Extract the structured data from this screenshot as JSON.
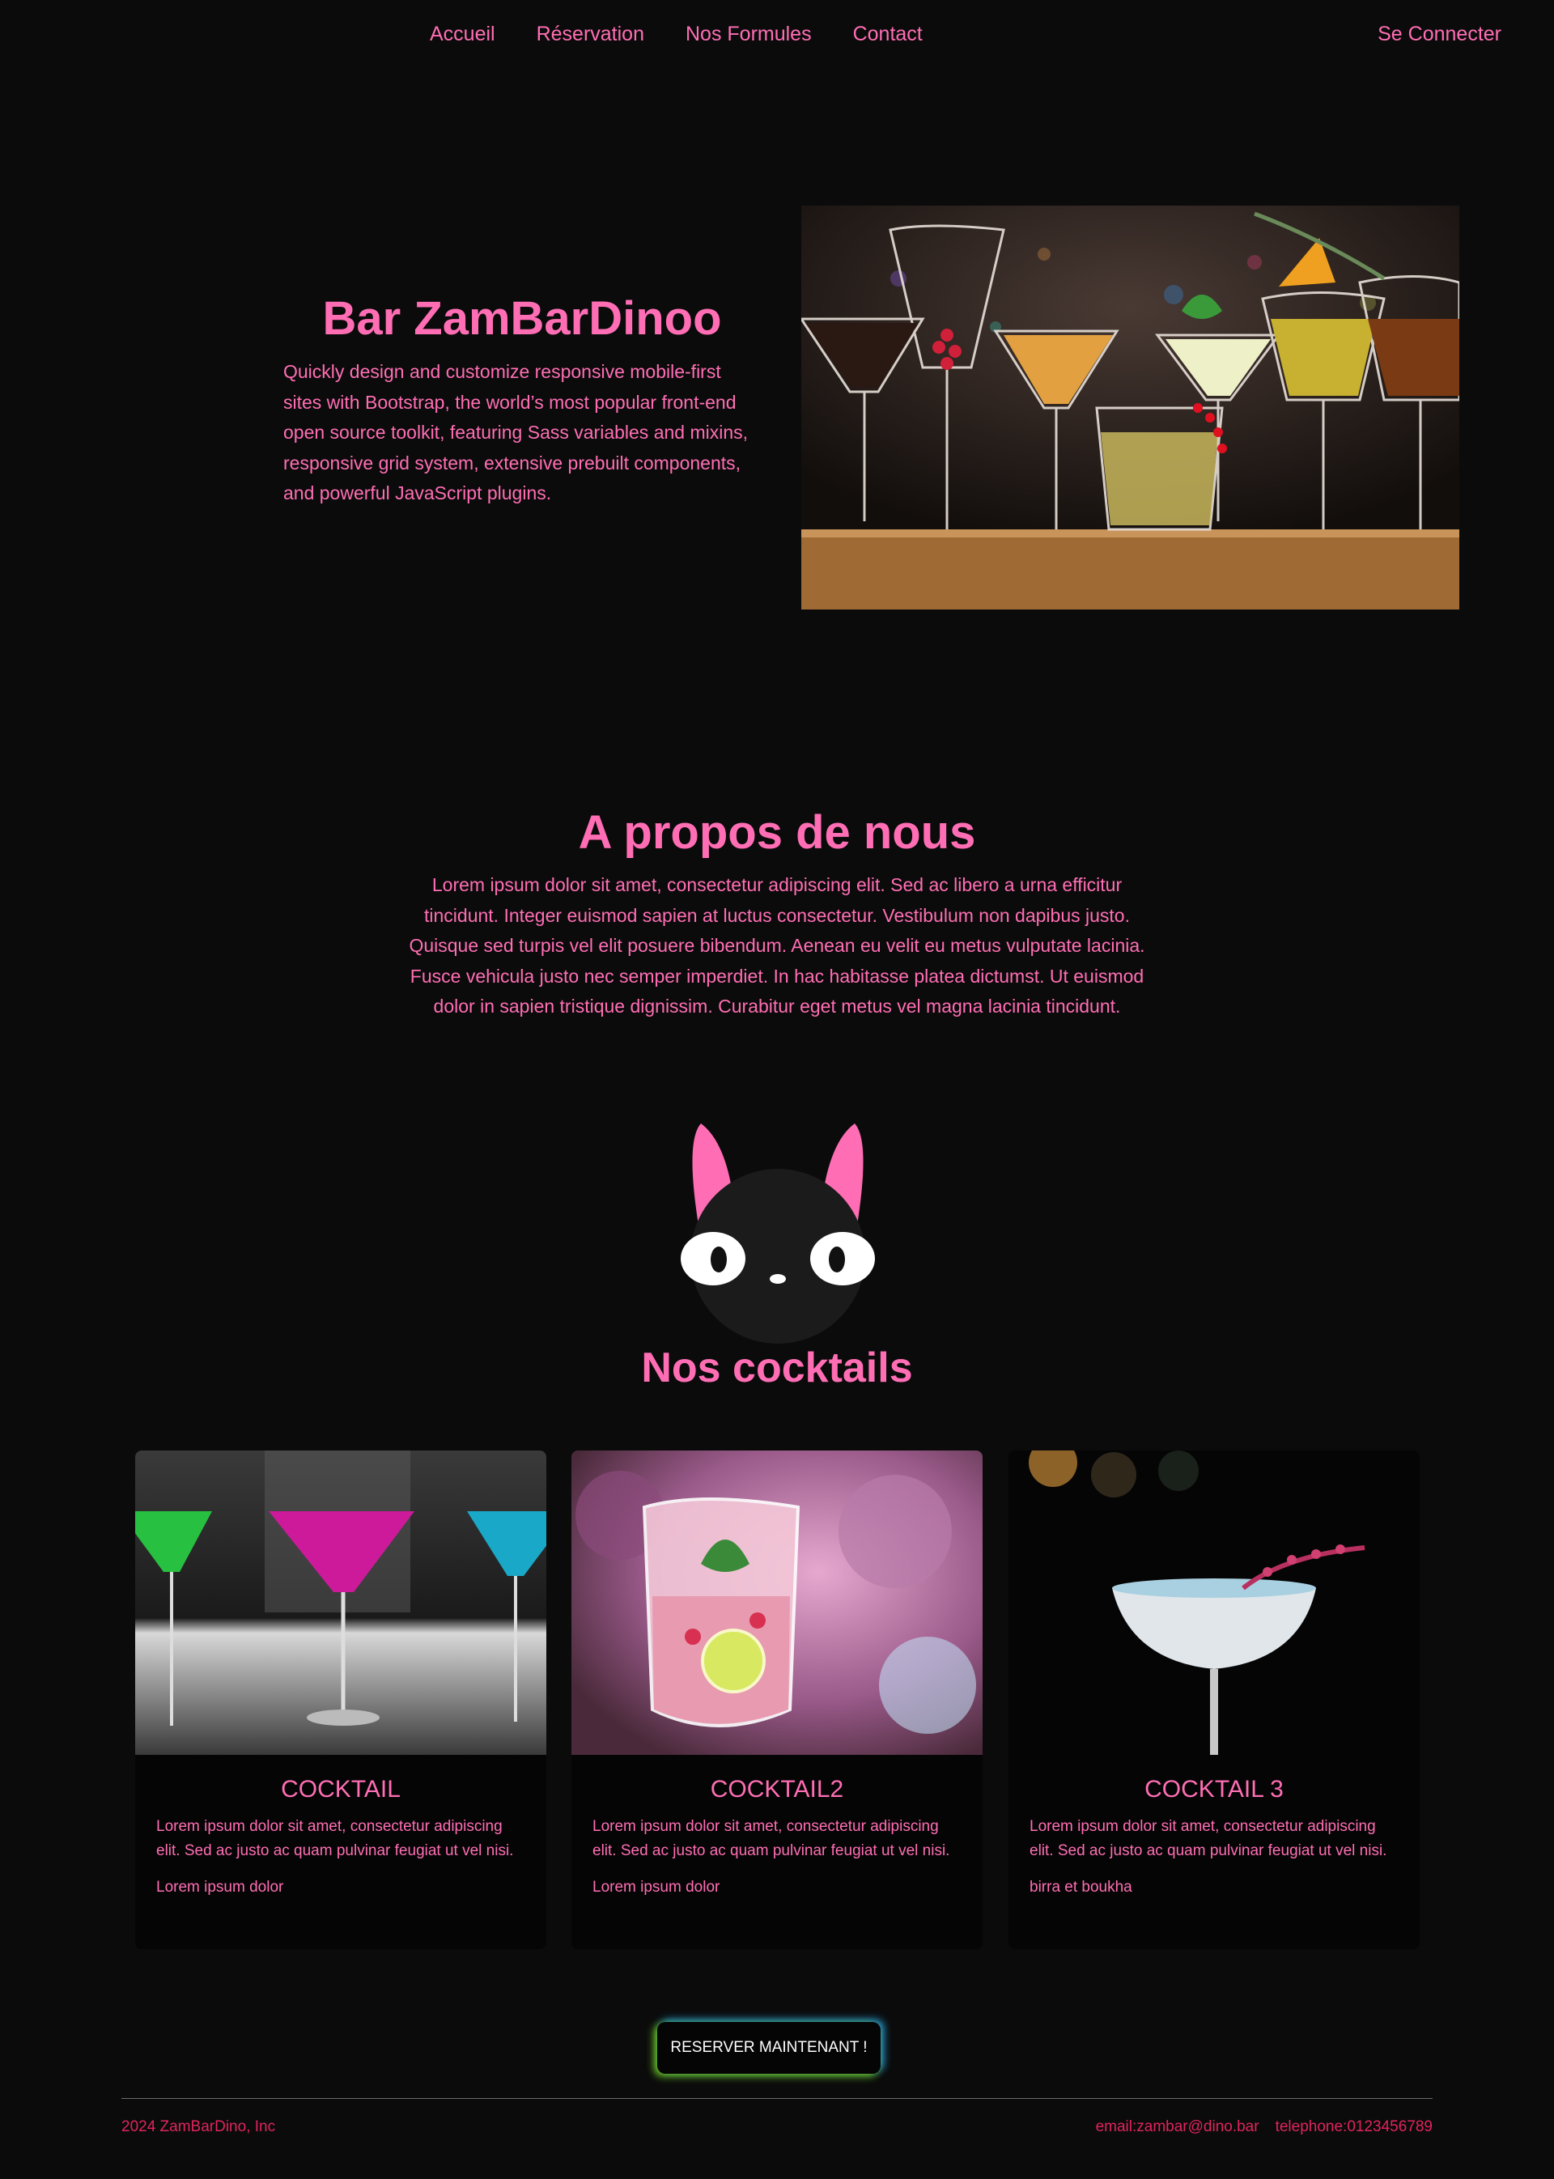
{
  "nav": {
    "links": [
      "Accueil",
      "Réservation",
      "Nos Formules",
      "Contact"
    ],
    "login": "Se Connecter"
  },
  "hero": {
    "title": "Bar ZamBarDinoo",
    "description": "Quickly design and customize responsive mobile-first sites with Bootstrap, the world’s most popular front-end open source toolkit, featuring Sass variables and mixins, responsive grid system, extensive prebuilt components, and powerful JavaScript plugins."
  },
  "about": {
    "title": "A propos de nous",
    "text": "Lorem ipsum dolor sit amet, consectetur adipiscing elit. Sed ac libero a urna efficitur tincidunt. Integer euismod sapien at luctus consectetur. Vestibulum non dapibus justo. Quisque sed turpis vel elit posuere bibendum. Aenean eu velit eu metus vulputate lacinia. Fusce vehicula justo nec semper imperdiet. In hac habitasse platea dictumst. Ut euismod dolor in sapien tristique dignissim. Curabitur eget metus vel magna lacinia tincidunt."
  },
  "cocktails": {
    "title": "Nos cocktails",
    "cards": [
      {
        "title": "COCKTAIL",
        "text": "Lorem ipsum dolor sit amet, consectetur adipiscing elit. Sed ac justo ac quam pulvinar feugiat ut vel nisi.",
        "footer": "Lorem ipsum dolor"
      },
      {
        "title": "COCKTAIL2",
        "text": "Lorem ipsum dolor sit amet, consectetur adipiscing elit. Sed ac justo ac quam pulvinar feugiat ut vel nisi.",
        "footer": "Lorem ipsum dolor"
      },
      {
        "title": "COCKTAIL 3",
        "text": "Lorem ipsum dolor sit amet, consectetur adipiscing elit. Sed ac justo ac quam pulvinar feugiat ut vel nisi.",
        "footer": "birra et boukha"
      }
    ]
  },
  "cta": {
    "label": "RESERVER MAINTENANT !"
  },
  "footer": {
    "copyright": "2024 ZamBarDino, Inc",
    "email": "email:zambar@dino.bar",
    "phone": "telephone:0123456789"
  },
  "colors": {
    "accent": "#ff6eb4",
    "background": "#0b0b0b",
    "footer_text": "#e0245e"
  }
}
